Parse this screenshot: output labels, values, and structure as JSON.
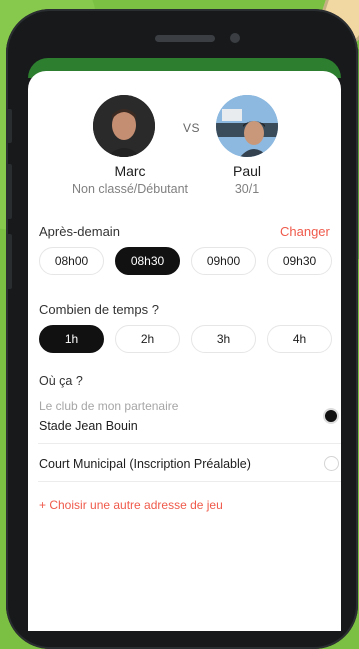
{
  "players": {
    "left": {
      "name": "Marc",
      "rank": "Non classé/Débutant"
    },
    "vs": "VS",
    "right": {
      "name": "Paul",
      "rank": "30/1"
    }
  },
  "date": {
    "label": "Après-demain",
    "change": "Changer"
  },
  "times": [
    "08h00",
    "08h30",
    "09h00",
    "09h30"
  ],
  "selected_time": "08h30",
  "duration": {
    "label": "Combien de temps ?",
    "options": [
      "1h",
      "2h",
      "3h",
      "4h"
    ],
    "selected": "1h"
  },
  "location": {
    "label": "Où ça ?",
    "partner_label": "Le club de mon partenaire",
    "options": [
      "Stade Jean Bouin",
      "Court Municipal (Inscription Préalable)"
    ],
    "selected": "Stade Jean Bouin",
    "add": "+ Choisir une autre adresse de jeu"
  },
  "colors": {
    "accent": "#ef5a4b",
    "selected": "#111111",
    "background": "#7cc043"
  }
}
